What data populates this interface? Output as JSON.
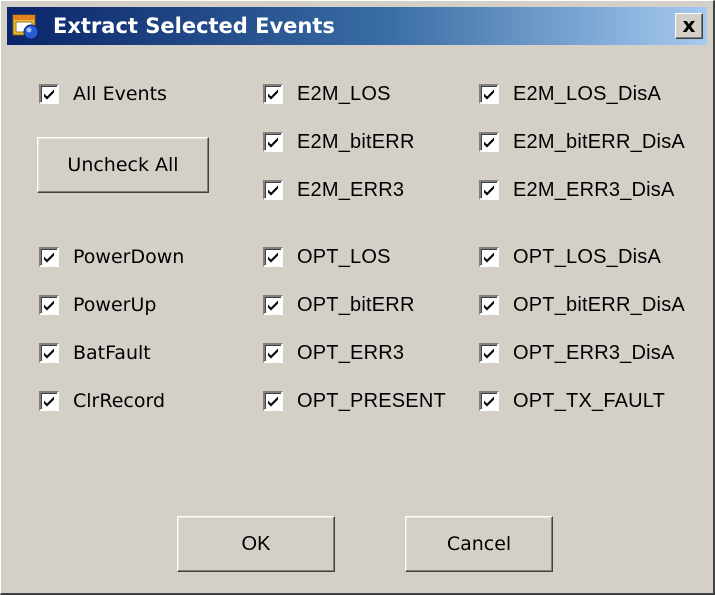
{
  "window": {
    "title": "Extract Selected Events",
    "close_label": "x"
  },
  "buttons": {
    "uncheck_all": "Uncheck All",
    "ok": "OK",
    "cancel": "Cancel"
  },
  "checkboxes": {
    "all_events": {
      "label": "All Events",
      "checked": true
    },
    "powerdown": {
      "label": "PowerDown",
      "checked": true
    },
    "powerup": {
      "label": "PowerUp",
      "checked": true
    },
    "batfault": {
      "label": "BatFault",
      "checked": true
    },
    "clrrecord": {
      "label": "ClrRecord",
      "checked": true
    },
    "e2m_los": {
      "label": "E2M_LOS",
      "checked": true
    },
    "e2m_biterr": {
      "label": "E2M_bitERR",
      "checked": true
    },
    "e2m_err3": {
      "label": "E2M_ERR3",
      "checked": true
    },
    "opt_los": {
      "label": "OPT_LOS",
      "checked": true
    },
    "opt_biterr": {
      "label": "OPT_bitERR",
      "checked": true
    },
    "opt_err3": {
      "label": "OPT_ERR3",
      "checked": true
    },
    "opt_present": {
      "label": "OPT_PRESENT",
      "checked": true
    },
    "e2m_los_disa": {
      "label": "E2M_LOS_DisA",
      "checked": true
    },
    "e2m_biterr_disa": {
      "label": "E2M_bitERR_DisA",
      "checked": true
    },
    "e2m_err3_disa": {
      "label": "E2M_ERR3_DisA",
      "checked": true
    },
    "opt_los_disa": {
      "label": "OPT_LOS_DisA",
      "checked": true
    },
    "opt_biterr_disa": {
      "label": "OPT_bitERR_DisA",
      "checked": true
    },
    "opt_err3_disa": {
      "label": "OPT_ERR3_DisA",
      "checked": true
    },
    "opt_tx_fault": {
      "label": "OPT_TX_FAULT",
      "checked": true
    }
  },
  "icons": {
    "app": "app-window-icon",
    "check": "checkmark-icon",
    "close": "close-icon"
  }
}
